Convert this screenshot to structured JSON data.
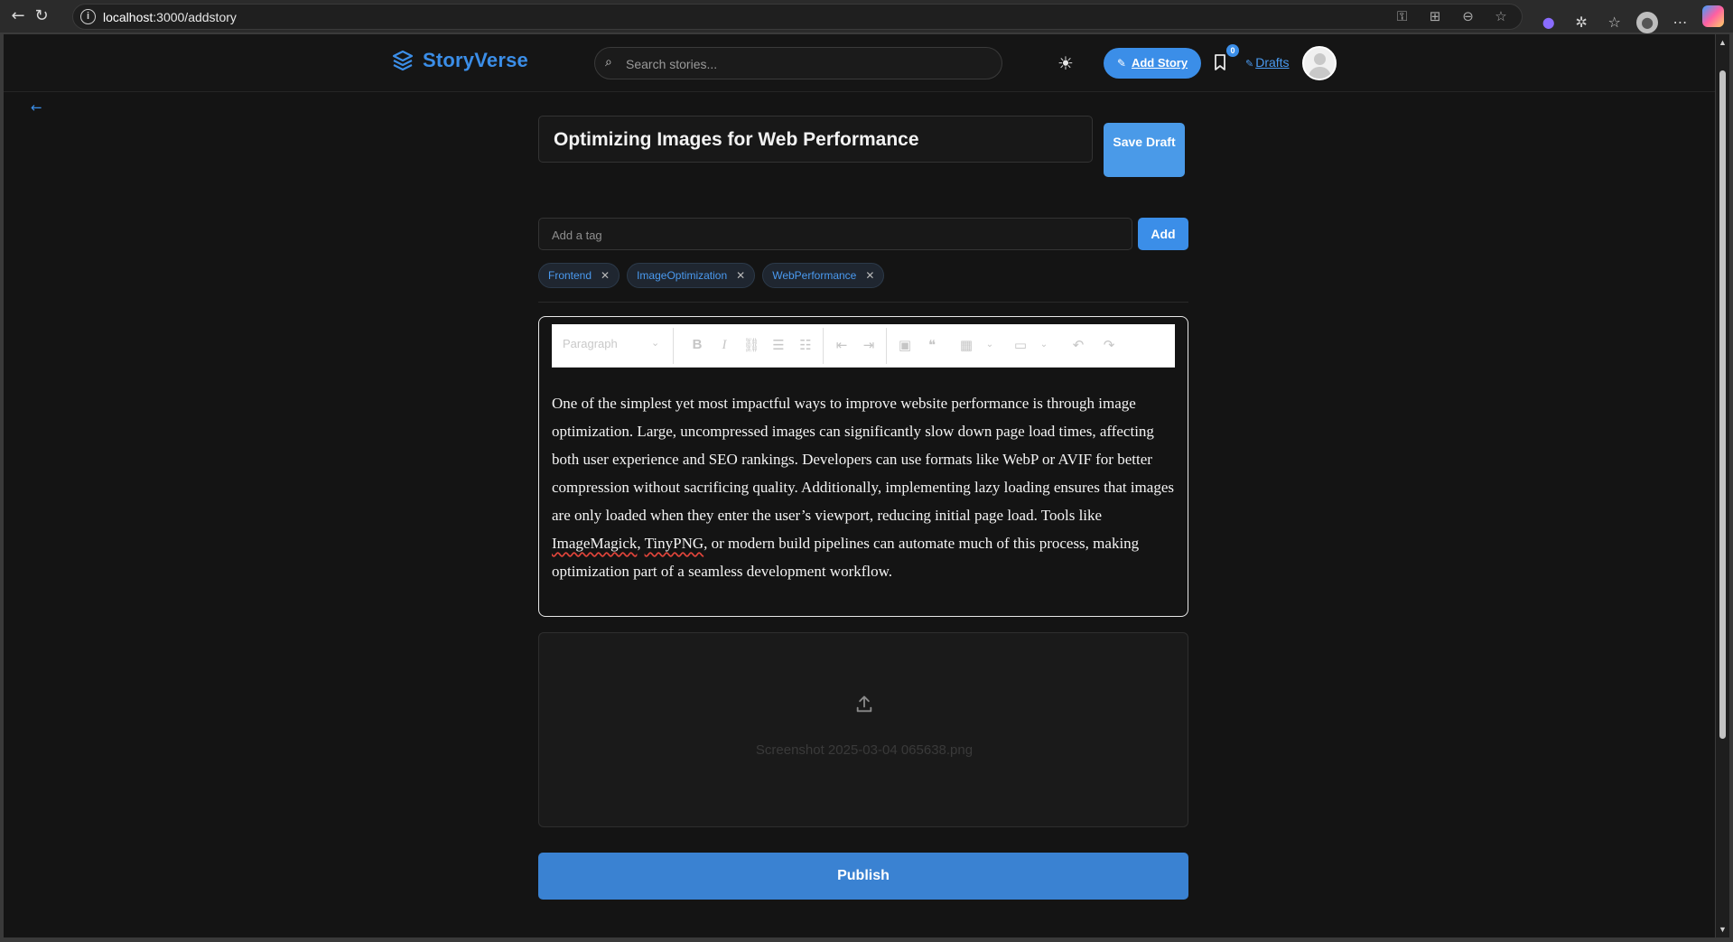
{
  "browser": {
    "url_host": "localhost",
    "url_path": ":3000/addstory",
    "nav_icons": [
      "back-arrow-icon",
      "reload-icon"
    ]
  },
  "header": {
    "logo_text": "StoryVerse",
    "search_placeholder": "Search stories...",
    "add_story_label": "Add Story",
    "bookmark_count": "0",
    "drafts_label": "Drafts"
  },
  "editor": {
    "title": "Optimizing Images for Web Performance",
    "save_draft_label": "Save Draft",
    "tag_placeholder": "Add a tag",
    "add_tag_label": "Add",
    "tags": [
      "Frontend",
      "ImageOptimization",
      "WebPerformance"
    ],
    "toolbar": {
      "block_style": "Paragraph",
      "buttons": [
        "bold-icon",
        "italic-icon",
        "link-icon",
        "bulleted-list-icon",
        "numbered-list-icon",
        "outdent-icon",
        "indent-icon",
        "image-icon",
        "blockquote-icon",
        "table-icon",
        "media-icon",
        "undo-icon",
        "redo-icon"
      ]
    },
    "body_parts": {
      "p1": "One of the simplest yet most impactful ways to improve website performance is through image optimization. Large, uncompressed images can significantly slow down page load times, affecting both user experience and SEO rankings. Developers can use formats like WebP or AVIF for better compression without sacrificing quality. Additionally, implementing lazy loading ensures that images are only loaded when they enter the user’s viewport, reducing initial page load. Tools like ",
      "w1": "ImageMagick",
      "sep": ", ",
      "w2": "TinyPNG",
      "p2": ", or modern build pipelines can automate much of this process, making optimization part of a seamless development workflow."
    },
    "upload_filename": "Screenshot 2025-03-04 065638.png",
    "publish_label": "Publish"
  }
}
